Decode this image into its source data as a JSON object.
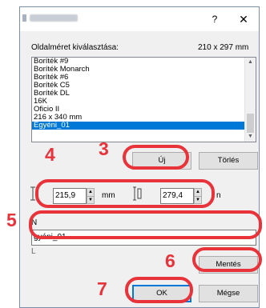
{
  "dialog": {
    "help": "?",
    "close": "✕",
    "paper_size_label": "Oldalméret kiválasztása:",
    "paper_size_value": "210 x 297 mm"
  },
  "list": {
    "items": [
      "Boríték #9",
      "Boríték Monarch",
      "Boríték #6",
      "Boríték C5",
      "Boríték DL",
      "16K",
      "Oficio II",
      "216 x 340 mm",
      "Egyéni_01"
    ],
    "selected_index": 8
  },
  "buttons": {
    "new": "Új",
    "delete": "Törlés",
    "save": "Mentés",
    "ok": "OK",
    "cancel": "Mégse"
  },
  "size": {
    "width": "215,9",
    "height": "279,4",
    "unit": "mm",
    "unit_partial": "n"
  },
  "name": {
    "label_partial": "N",
    "value": "gyéni_01",
    "under_partial": "L"
  },
  "steps": {
    "s3": "3",
    "s4": "4",
    "s5": "5",
    "s6": "6",
    "s7": "7"
  },
  "colors": {
    "accent": "#e8333a",
    "selection": "#0078d7",
    "dialog_bg": "#f0f0f0"
  }
}
